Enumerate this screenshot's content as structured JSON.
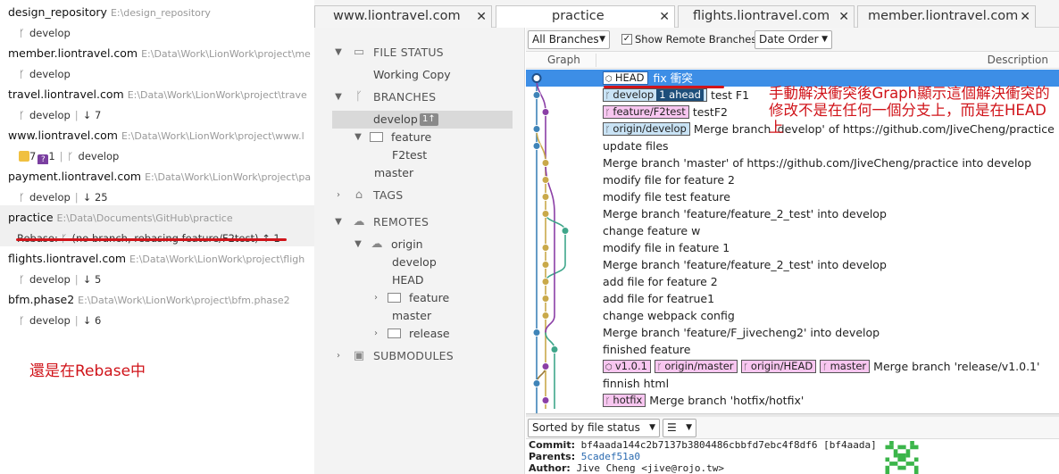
{
  "repos": [
    {
      "name": "design_repository",
      "path": "E:\\design_repository",
      "branch": "develop",
      "status": ""
    },
    {
      "name": "member.liontravel.com",
      "path": "E:\\Data\\Work\\LionWork\\project\\me",
      "branch": "develop",
      "status": ""
    },
    {
      "name": "travel.liontravel.com",
      "path": "E:\\Data\\Work\\LionWork\\project\\trave",
      "branch": "develop",
      "status": "↓ 7"
    },
    {
      "name": "www.liontravel.com",
      "path": "E:\\Data\\Work\\LionWork\\project\\www.l",
      "branch": "develop",
      "status": "",
      "badge_count1": "7",
      "badge_count2": "1"
    },
    {
      "name": "payment.liontravel.com",
      "path": "E:\\Data\\Work\\LionWork\\project\\pa",
      "branch": "develop",
      "status": "↓ 25"
    },
    {
      "name": "practice",
      "path": "E:\\Data\\Documents\\GitHub\\practice",
      "branch_prefix": "Rebase:",
      "branch": "(no branch, rebasing feature/F2test)",
      "status": "↑ 1"
    },
    {
      "name": "flights.liontravel.com",
      "path": "E:\\Data\\Work\\LionWork\\project\\fligh",
      "branch": "develop",
      "status": "↓ 5"
    },
    {
      "name": "bfm.phase2",
      "path": "E:\\Data\\Work\\LionWork\\project\\bfm.phase2",
      "branch": "develop",
      "status": "↓ 6"
    }
  ],
  "annotation_left": "還是在Rebase中",
  "annotation_right": "手動解決衝突後Graph顯示這個解決衝突的修改不是在任何一個分支上，而是在HEAD上",
  "tabs": [
    {
      "label": "www.liontravel.com"
    },
    {
      "label": "practice"
    },
    {
      "label": "flights.liontravel.com"
    },
    {
      "label": "member.liontravel.com"
    }
  ],
  "sidebar": {
    "file_status": "FILE STATUS",
    "working_copy": "Working Copy",
    "branches": "BRANCHES",
    "develop": "develop",
    "develop_badge": "1↑",
    "feature": "feature",
    "f2test": "F2test",
    "master": "master",
    "tags": "TAGS",
    "remotes": "REMOTES",
    "origin": "origin",
    "origin_develop": "develop",
    "origin_head": "HEAD",
    "origin_feature": "feature",
    "origin_master": "master",
    "origin_release": "release",
    "submodules": "SUBMODULES"
  },
  "toolbar": {
    "branches_select": "All Branches",
    "show_remote": "Show Remote Branches",
    "order_select": "Date Order"
  },
  "columns": {
    "graph": "Graph",
    "description": "Description"
  },
  "commits": [
    {
      "refs": [
        {
          "text": "HEAD",
          "kind": "head"
        }
      ],
      "message": "fix 衝突"
    },
    {
      "refs": [
        {
          "text": "develop",
          "kind": "blue",
          "ahead": "1 ahead"
        }
      ],
      "message": "test F1"
    },
    {
      "refs": [
        {
          "text": "feature/F2test",
          "kind": "pink"
        }
      ],
      "message": "testF2"
    },
    {
      "refs": [
        {
          "text": "origin/develop",
          "kind": "blue"
        }
      ],
      "message": "Merge branch 'develop' of https://github.com/JiveCheng/practice into"
    },
    {
      "refs": [],
      "message": "update files"
    },
    {
      "refs": [],
      "message": "Merge branch 'master' of https://github.com/JiveCheng/practice into develop"
    },
    {
      "refs": [],
      "message": "modify file for feature 2"
    },
    {
      "refs": [],
      "message": "modify file test feature"
    },
    {
      "refs": [],
      "message": "Merge branch 'feature/feature_2_test' into develop"
    },
    {
      "refs": [],
      "message": "change feature w"
    },
    {
      "refs": [],
      "message": "modify file in feature 1"
    },
    {
      "refs": [],
      "message": "Merge branch 'feature/feature_2_test' into develop"
    },
    {
      "refs": [],
      "message": "add file for feature 2"
    },
    {
      "refs": [],
      "message": "add file for featrue1"
    },
    {
      "refs": [],
      "message": "change webpack config"
    },
    {
      "refs": [],
      "message": "Merge branch 'feature/F_jivecheng2' into develop"
    },
    {
      "refs": [],
      "message": "finished feature"
    },
    {
      "refs": [
        {
          "text": "v1.0.1",
          "kind": "pink"
        },
        {
          "text": "origin/master",
          "kind": "pink"
        },
        {
          "text": "origin/HEAD",
          "kind": "pink"
        },
        {
          "text": "master",
          "kind": "pink"
        }
      ],
      "message": "Merge branch 'release/v1.0.1'"
    },
    {
      "refs": [],
      "message": "finnish html"
    },
    {
      "refs": [
        {
          "text": "hotfix",
          "kind": "pink"
        }
      ],
      "message": "Merge branch 'hotfix/hotfix'"
    }
  ],
  "file_sort": "Sorted by file status",
  "detail": {
    "commit_label": "Commit:",
    "commit_value": "bf4aada144c2b7137b3804486cbbfd7ebc4f8df6 [bf4aada]",
    "parents_label": "Parents:",
    "parents_value": "5cadef51a0",
    "author_label": "Author:",
    "author_value": "Jive Cheng <jive@rojo.tw>"
  },
  "colors": {
    "selection": "#3d8ee6",
    "annotation": "#d0141a",
    "lane_blue": "#3f84b8",
    "lane_olive": "#c9a94a",
    "lane_purple": "#8b3fa6",
    "lane_teal": "#3fa68a",
    "lane_brown": "#9a7a3a"
  }
}
